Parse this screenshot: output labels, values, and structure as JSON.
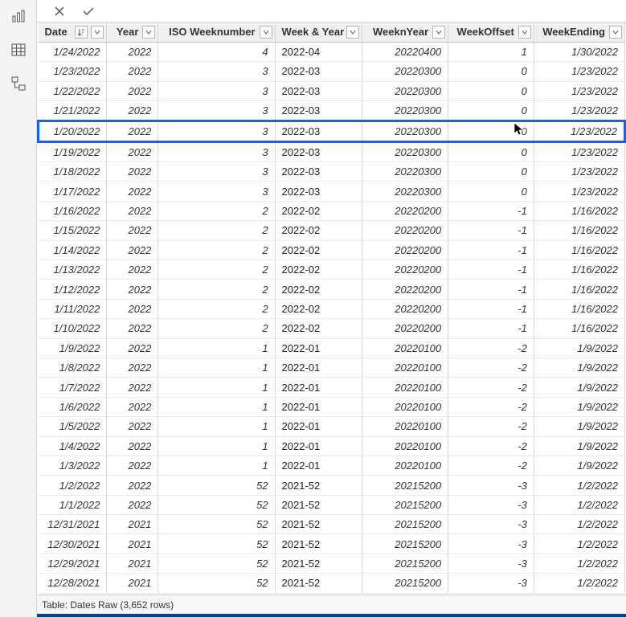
{
  "footer": {
    "label": "Table: Dates Raw (3,652 rows)"
  },
  "columns": [
    {
      "key": "date",
      "label": "Date",
      "align": "txt",
      "sort": true
    },
    {
      "key": "year",
      "label": "Year",
      "align": "num",
      "sort": false
    },
    {
      "key": "iso",
      "label": "ISO Weeknumber",
      "align": "num",
      "sort": false
    },
    {
      "key": "wy",
      "label": "Week & Year",
      "align": "txt",
      "sort": false
    },
    {
      "key": "wny",
      "label": "WeeknYear",
      "align": "num",
      "sort": false
    },
    {
      "key": "off",
      "label": "WeekOffset",
      "align": "num",
      "sort": false
    },
    {
      "key": "we",
      "label": "WeekEnding",
      "align": "num",
      "sort": false
    }
  ],
  "highlight_row_index": 4,
  "rows": [
    {
      "date": "1/24/2022",
      "year": "2022",
      "iso": "4",
      "wy": "2022-04",
      "wny": "20220400",
      "off": "1",
      "we": "1/30/2022"
    },
    {
      "date": "1/23/2022",
      "year": "2022",
      "iso": "3",
      "wy": "2022-03",
      "wny": "20220300",
      "off": "0",
      "we": "1/23/2022"
    },
    {
      "date": "1/22/2022",
      "year": "2022",
      "iso": "3",
      "wy": "2022-03",
      "wny": "20220300",
      "off": "0",
      "we": "1/23/2022"
    },
    {
      "date": "1/21/2022",
      "year": "2022",
      "iso": "3",
      "wy": "2022-03",
      "wny": "20220300",
      "off": "0",
      "we": "1/23/2022"
    },
    {
      "date": "1/20/2022",
      "year": "2022",
      "iso": "3",
      "wy": "2022-03",
      "wny": "20220300",
      "off": "0",
      "we": "1/23/2022"
    },
    {
      "date": "1/19/2022",
      "year": "2022",
      "iso": "3",
      "wy": "2022-03",
      "wny": "20220300",
      "off": "0",
      "we": "1/23/2022"
    },
    {
      "date": "1/18/2022",
      "year": "2022",
      "iso": "3",
      "wy": "2022-03",
      "wny": "20220300",
      "off": "0",
      "we": "1/23/2022"
    },
    {
      "date": "1/17/2022",
      "year": "2022",
      "iso": "3",
      "wy": "2022-03",
      "wny": "20220300",
      "off": "0",
      "we": "1/23/2022"
    },
    {
      "date": "1/16/2022",
      "year": "2022",
      "iso": "2",
      "wy": "2022-02",
      "wny": "20220200",
      "off": "-1",
      "we": "1/16/2022"
    },
    {
      "date": "1/15/2022",
      "year": "2022",
      "iso": "2",
      "wy": "2022-02",
      "wny": "20220200",
      "off": "-1",
      "we": "1/16/2022"
    },
    {
      "date": "1/14/2022",
      "year": "2022",
      "iso": "2",
      "wy": "2022-02",
      "wny": "20220200",
      "off": "-1",
      "we": "1/16/2022"
    },
    {
      "date": "1/13/2022",
      "year": "2022",
      "iso": "2",
      "wy": "2022-02",
      "wny": "20220200",
      "off": "-1",
      "we": "1/16/2022"
    },
    {
      "date": "1/12/2022",
      "year": "2022",
      "iso": "2",
      "wy": "2022-02",
      "wny": "20220200",
      "off": "-1",
      "we": "1/16/2022"
    },
    {
      "date": "1/11/2022",
      "year": "2022",
      "iso": "2",
      "wy": "2022-02",
      "wny": "20220200",
      "off": "-1",
      "we": "1/16/2022"
    },
    {
      "date": "1/10/2022",
      "year": "2022",
      "iso": "2",
      "wy": "2022-02",
      "wny": "20220200",
      "off": "-1",
      "we": "1/16/2022"
    },
    {
      "date": "1/9/2022",
      "year": "2022",
      "iso": "1",
      "wy": "2022-01",
      "wny": "20220100",
      "off": "-2",
      "we": "1/9/2022"
    },
    {
      "date": "1/8/2022",
      "year": "2022",
      "iso": "1",
      "wy": "2022-01",
      "wny": "20220100",
      "off": "-2",
      "we": "1/9/2022"
    },
    {
      "date": "1/7/2022",
      "year": "2022",
      "iso": "1",
      "wy": "2022-01",
      "wny": "20220100",
      "off": "-2",
      "we": "1/9/2022"
    },
    {
      "date": "1/6/2022",
      "year": "2022",
      "iso": "1",
      "wy": "2022-01",
      "wny": "20220100",
      "off": "-2",
      "we": "1/9/2022"
    },
    {
      "date": "1/5/2022",
      "year": "2022",
      "iso": "1",
      "wy": "2022-01",
      "wny": "20220100",
      "off": "-2",
      "we": "1/9/2022"
    },
    {
      "date": "1/4/2022",
      "year": "2022",
      "iso": "1",
      "wy": "2022-01",
      "wny": "20220100",
      "off": "-2",
      "we": "1/9/2022"
    },
    {
      "date": "1/3/2022",
      "year": "2022",
      "iso": "1",
      "wy": "2022-01",
      "wny": "20220100",
      "off": "-2",
      "we": "1/9/2022"
    },
    {
      "date": "1/2/2022",
      "year": "2022",
      "iso": "52",
      "wy": "2021-52",
      "wny": "20215200",
      "off": "-3",
      "we": "1/2/2022"
    },
    {
      "date": "1/1/2022",
      "year": "2022",
      "iso": "52",
      "wy": "2021-52",
      "wny": "20215200",
      "off": "-3",
      "we": "1/2/2022"
    },
    {
      "date": "12/31/2021",
      "year": "2021",
      "iso": "52",
      "wy": "2021-52",
      "wny": "20215200",
      "off": "-3",
      "we": "1/2/2022"
    },
    {
      "date": "12/30/2021",
      "year": "2021",
      "iso": "52",
      "wy": "2021-52",
      "wny": "20215200",
      "off": "-3",
      "we": "1/2/2022"
    },
    {
      "date": "12/29/2021",
      "year": "2021",
      "iso": "52",
      "wy": "2021-52",
      "wny": "20215200",
      "off": "-3",
      "we": "1/2/2022"
    },
    {
      "date": "12/28/2021",
      "year": "2021",
      "iso": "52",
      "wy": "2021-52",
      "wny": "20215200",
      "off": "-3",
      "we": "1/2/2022"
    }
  ]
}
